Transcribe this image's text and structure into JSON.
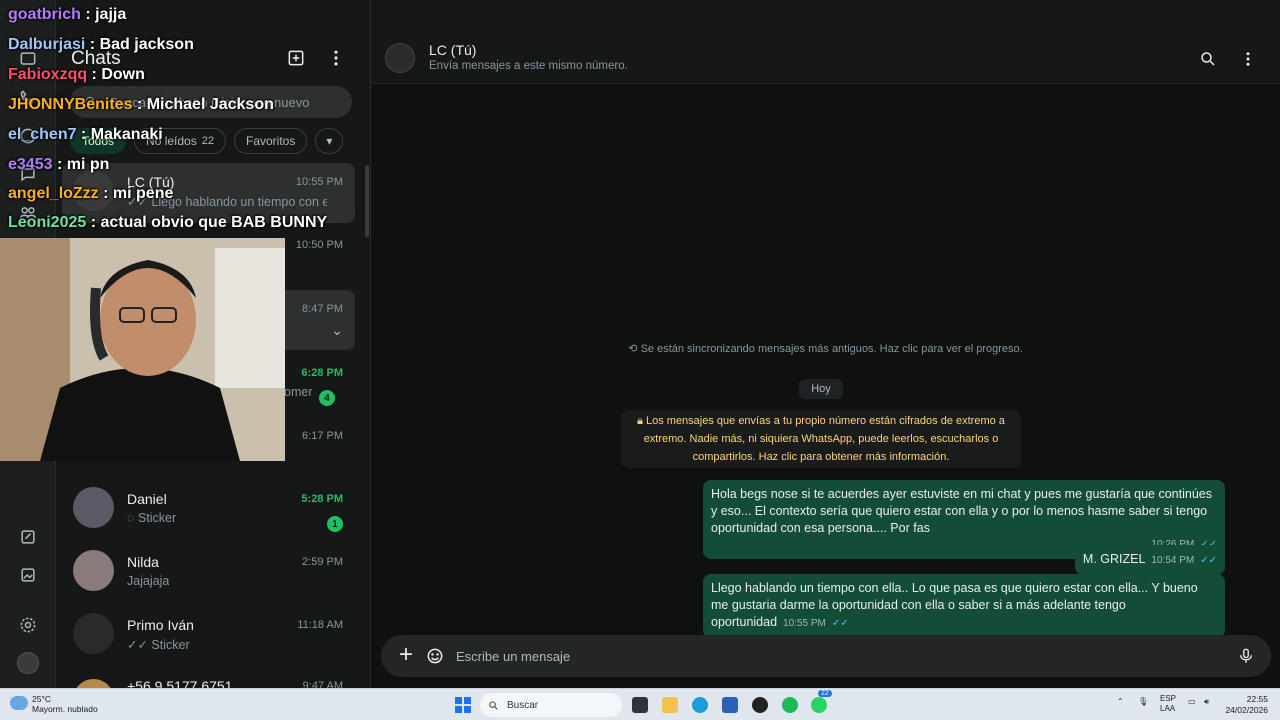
{
  "window": {
    "minimize": "—",
    "maximize": "▢",
    "close": "✕"
  },
  "sidebar_panel": {
    "title": "Chats",
    "search_placeholder": "Buscar un chat o iniciar uno nuevo",
    "filters": [
      {
        "label": "Todos",
        "count": ""
      },
      {
        "label": "No leídos",
        "count": "22"
      },
      {
        "label": "Favoritos",
        "count": ""
      }
    ],
    "chats": [
      {
        "name": "LC (Tú)",
        "preview": "✓✓ Llego hablando un tiempo con ella.....",
        "time": "10:55 PM",
        "unread": ""
      },
      {
        "name": "",
        "preview": "",
        "time": "10:50 PM",
        "unread": ""
      },
      {
        "name": "",
        "preview": "",
        "time": "8:47 PM",
        "unread": ""
      },
      {
        "name": "",
        "preview": "omer",
        "time": "6:28 PM",
        "unread": "4"
      },
      {
        "name": "",
        "preview": "",
        "time": "6:17 PM",
        "unread": ""
      },
      {
        "name": "Daniel",
        "preview": "Sticker",
        "time": "5:28 PM",
        "unread": "1"
      },
      {
        "name": "Nilda",
        "preview": "Jajajaja",
        "time": "2:59 PM",
        "unread": ""
      },
      {
        "name": "Primo Iván",
        "preview": "✓✓ Sticker",
        "time": "11:18 AM",
        "unread": ""
      },
      {
        "name": "+56 9 5177 6751",
        "preview": "",
        "time": "9:47 AM",
        "unread": ""
      }
    ]
  },
  "conversation": {
    "name": "LC (Tú)",
    "subtitle": "Envía mensajes a este mismo número.",
    "sync_note": "Se están sincronizando mensajes más antiguos. Haz clic para ver el progreso.",
    "day_label": "Hoy",
    "encryption_note": "Los mensajes que envías a tu propio número están cifrados de extremo a extremo. Nadie más, ni siquiera WhatsApp, puede leerlos, escucharlos o compartirlos. Haz clic para obtener más información.",
    "messages": [
      {
        "text": "Hola begs nose si te acuerdes ayer estuviste en mi chat y pues me gustaría que continúes y eso... El contexto sería que quiero estar con ella y o por lo menos hasme saber si tengo oportunidad con esa persona.... Por fas",
        "time": "10:26 PM"
      },
      {
        "text": "M. GRIZEL",
        "time": "10:54 PM"
      },
      {
        "text": "Llego hablando un tiempo con ella.. Lo que pasa es que quiero estar con ella... Y bueno me gustaria darme la oportunidad con ella o saber si a más adelante tengo oportunidad",
        "time": "10:55 PM"
      }
    ],
    "composer_placeholder": "Escribe un mensaje"
  },
  "stream_chat": [
    {
      "user": "goatbrich",
      "color": "#b57cff",
      "msg": "jajja"
    },
    {
      "user": "Dalburjasi",
      "color": "#9ec8ff",
      "msg": "Bad jackson"
    },
    {
      "user": "Fabioxzqq",
      "color": "#ff4d6d",
      "msg": "Down"
    },
    {
      "user": "JHONNYBenites",
      "color": "#ffb020",
      "msg": "Michael Jackson"
    },
    {
      "user": "el_chen7",
      "color": "#9ec8ff",
      "msg": "Makanaki"
    },
    {
      "user": "e3453",
      "color": "#b57cff",
      "msg": "mi pn"
    },
    {
      "user": "angel_loZzz",
      "color": "#ffb020",
      "msg": "mi pene"
    },
    {
      "user": "Leoni2025",
      "color": "#6fe3a0",
      "msg": "actual obvio que BAB BUNNY"
    }
  ],
  "taskbar": {
    "temp": "25°C",
    "weather": "Mayorm. nublado",
    "search": "Buscar",
    "badge": "22",
    "lang": "ESP",
    "lang2": "LAA",
    "time": "22:55",
    "date": "24/02/2026"
  },
  "colors": {
    "accent": "#21c063",
    "bubble_out": "#144d37",
    "note": "#ffd279"
  }
}
